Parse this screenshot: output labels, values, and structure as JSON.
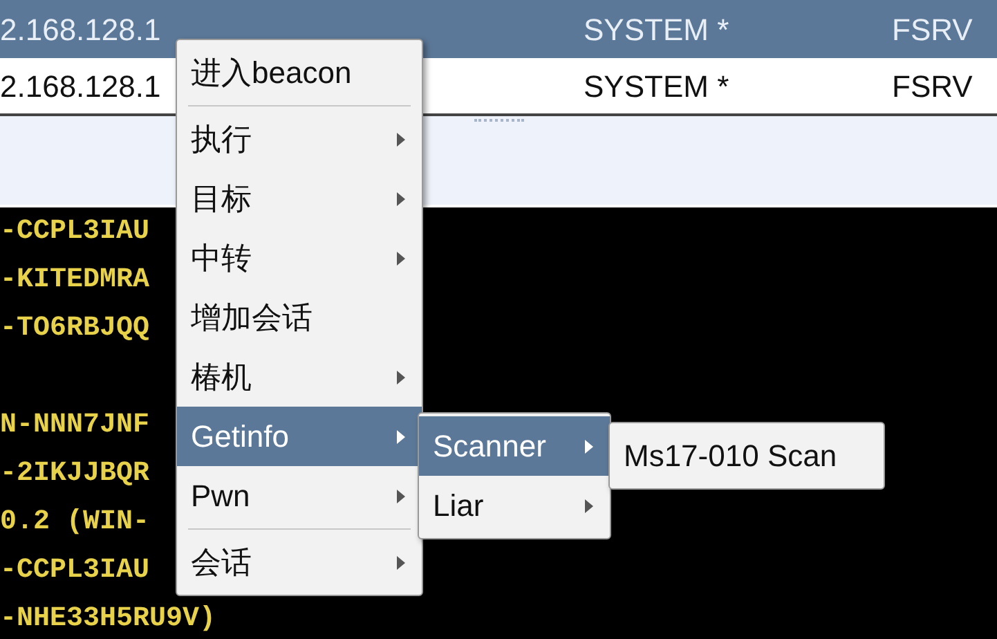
{
  "table": {
    "rows": [
      {
        "selected": true,
        "cells": [
          "2.168.128.1",
          "SYSTEM *",
          "FSRV"
        ]
      },
      {
        "selected": false,
        "cells": [
          "2.168.128.1",
          "SYSTEM *",
          "FSRV"
        ]
      }
    ]
  },
  "console": {
    "blocks": [
      [
        "-CCPL3IAU",
        "-KITEDMRA",
        "-TO6RBJQQ"
      ],
      [
        "N-NNN7JNF",
        "-2IKJJBQR",
        "0.2 (WIN-",
        "-CCPL3IAU",
        "-NHE33H5RU9V)"
      ]
    ]
  },
  "context_menu": {
    "items": [
      {
        "kind": "item",
        "label": "进入beacon",
        "submenu": false,
        "selected": false
      },
      {
        "kind": "separator"
      },
      {
        "kind": "item",
        "label": "执行",
        "submenu": true,
        "selected": false
      },
      {
        "kind": "item",
        "label": "目标",
        "submenu": true,
        "selected": false
      },
      {
        "kind": "item",
        "label": "中转",
        "submenu": true,
        "selected": false
      },
      {
        "kind": "item",
        "label": "增加会话",
        "submenu": false,
        "selected": false
      },
      {
        "kind": "item",
        "label": "椿机",
        "submenu": true,
        "selected": false
      },
      {
        "kind": "item",
        "label": "Getinfo",
        "submenu": true,
        "selected": true
      },
      {
        "kind": "item",
        "label": "Pwn",
        "submenu": true,
        "selected": false
      },
      {
        "kind": "separator"
      },
      {
        "kind": "item",
        "label": "会话",
        "submenu": true,
        "selected": false
      }
    ]
  },
  "submenu": {
    "items": [
      {
        "kind": "item",
        "label": "Scanner",
        "submenu": true,
        "selected": true
      },
      {
        "kind": "item",
        "label": "Liar",
        "submenu": true,
        "selected": false
      }
    ]
  },
  "sub_submenu": {
    "items": [
      {
        "kind": "item",
        "label": "Ms17-010 Scan",
        "submenu": false,
        "selected": false
      }
    ]
  }
}
